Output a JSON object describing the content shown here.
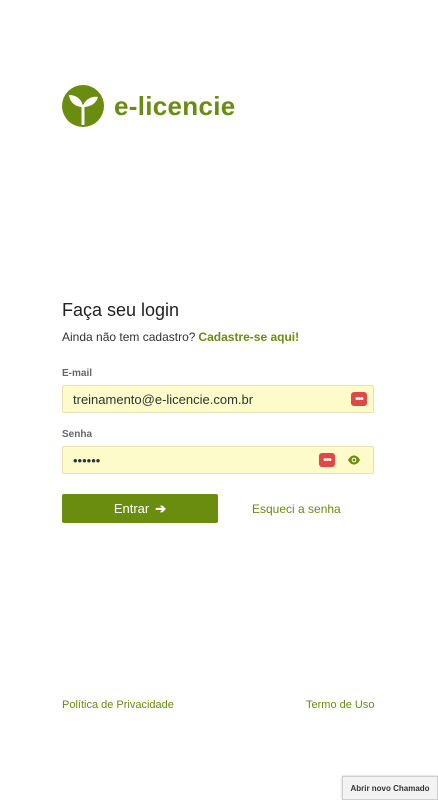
{
  "brand": {
    "name": "e-licencie",
    "color": "#6a8c0f"
  },
  "login": {
    "title": "Faça seu login",
    "signup_prompt": "Ainda não tem cadastro?",
    "signup_link": "Cadastre-se aqui!",
    "email_label": "E-mail",
    "email_value": "treinamento@e-licencie.com.br",
    "password_label": "Senha",
    "password_value": "••••••",
    "submit_label": "Entrar",
    "submit_icon": "arrow-right-icon",
    "forgot_label": "Esqueci a senha"
  },
  "footer": {
    "privacy_label": "Política de Privacidade",
    "terms_label": "Termo de Uso"
  },
  "support": {
    "ticket_label": "Abrir novo Chamado"
  },
  "icons": {
    "password_manager": "password-manager-icon",
    "show_password": "eye-icon"
  }
}
